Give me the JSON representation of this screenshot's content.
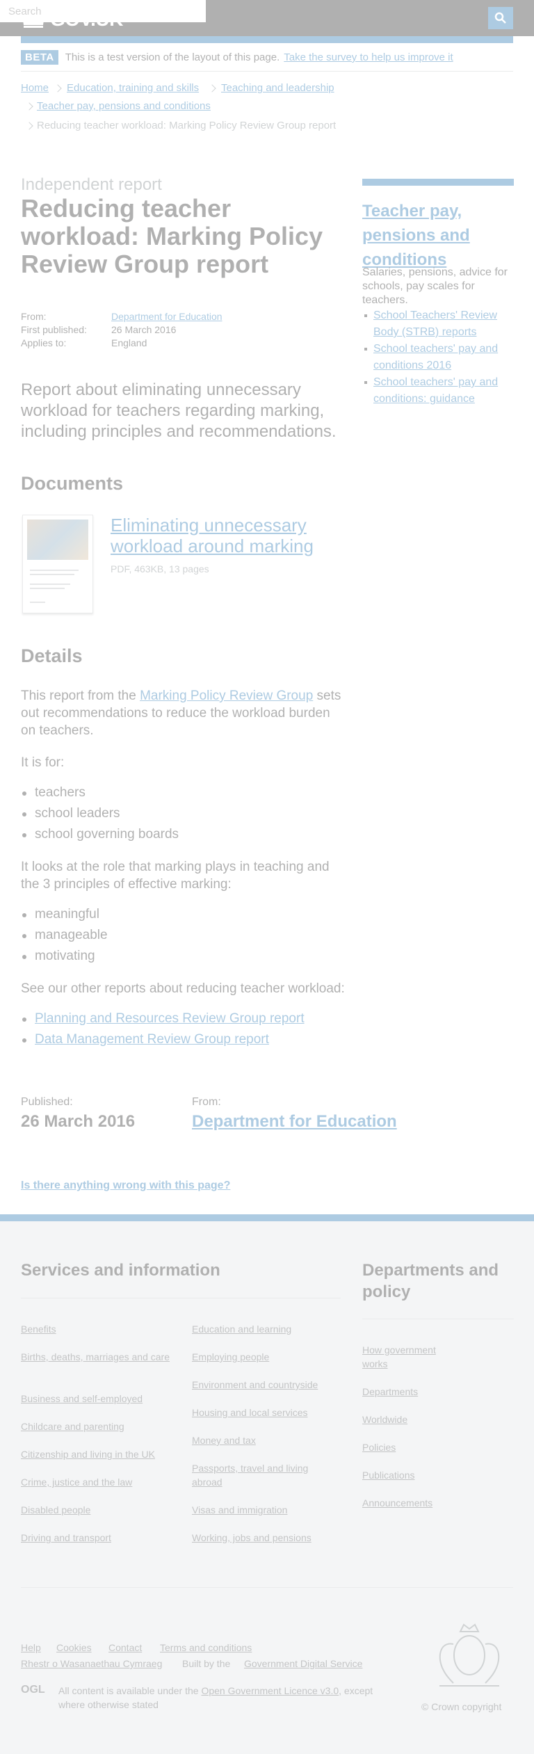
{
  "header": {
    "logo_text": "GOV.UK",
    "search_placeholder": "Search"
  },
  "beta": {
    "tag": "BETA",
    "text": "This is a test version of the layout of this page.",
    "link": "Take the survey to help us improve it"
  },
  "breadcrumb": {
    "items": [
      "Home",
      "Education, training and skills",
      "Teaching and leadership",
      "Teacher pay, pensions and conditions"
    ],
    "current": "Reducing teacher workload: Marking Policy Review Group report"
  },
  "title_block": {
    "kicker": "Independent report",
    "title": "Reducing teacher workload: Marking Policy Review Group report"
  },
  "metadata": {
    "from_label": "From:",
    "from_value": "Department for Education",
    "first_published_label": "First published:",
    "first_published_value": "26 March 2016",
    "applies_label": "Applies to:",
    "applies_value": "England"
  },
  "lead": "Report about eliminating unnecessary workload for teachers regarding marking, including principles and recommendations.",
  "sidebar": {
    "title": "Teacher pay, pensions and conditions",
    "description": "Salaries, pensions, advice for schools, pay scales for teachers.",
    "links": [
      "School Teachers' Review Body (STRB) reports",
      "School teachers' pay and conditions 2016",
      "School teachers' pay and conditions: guidance"
    ]
  },
  "documents": {
    "heading": "Documents",
    "title": "Eliminating unnecessary workload around marking",
    "meta": "PDF, 463KB, 13 pages"
  },
  "details": {
    "heading": "Details",
    "intro_before": "This report from the ",
    "intro_link": "Marking Policy Review Group",
    "intro_after": " sets out recommendations to reduce the workload burden on teachers.",
    "it_is_for": "It is for:",
    "audience": [
      "teachers",
      "school leaders",
      "school governing boards"
    ],
    "role_text": "It looks at the role that marking plays in teaching and the 3 principles of effective marking:",
    "principles": [
      "meaningful",
      "manageable",
      "motivating"
    ],
    "other_text": "See our other reports about reducing teacher workload:",
    "other_links": [
      "Planning and Resources Review Group report",
      "Data Management Review Group report"
    ]
  },
  "published": {
    "published_label": "Published:",
    "published_value": "26 March 2016",
    "from_label": "From:",
    "from_value": "Department for Education"
  },
  "feedback": {
    "link": "Is there anything wrong with this page?"
  },
  "footer": {
    "services_heading": "Services and information",
    "services_col1": [
      "Benefits",
      "Births, deaths, marriages and care",
      "Business and self-employed",
      "Childcare and parenting",
      "Citizenship and living in the UK",
      "Crime, justice and the law",
      "Disabled people",
      "Driving and transport"
    ],
    "services_col2": [
      "Education and learning",
      "Employing people",
      "Environment and countryside",
      "Housing and local services",
      "Money and tax",
      "Passports, travel and living abroad",
      "Visas and immigration",
      "Working, jobs and pensions"
    ],
    "departments_heading": "Departments and policy",
    "departments_links": [
      "How government works",
      "Departments",
      "Worldwide",
      "Policies",
      "Publications",
      "Announcements"
    ],
    "bottom_links": [
      "Help",
      "Cookies",
      "Contact",
      "Terms and conditions",
      "Rhestr o Wasanaethau Cymraeg"
    ],
    "built_by_text": "Built by the",
    "built_by_link": "Government Digital Service",
    "ogl": "OGL",
    "licence_before": "All content is available under the ",
    "licence_link": "Open Government Licence v3.0",
    "licence_after": ", except where otherwise stated",
    "copyright": "© Crown copyright"
  },
  "colors": {
    "link": "#005ea5",
    "header_bg": "#0b0c0c",
    "footer_bg": "#dee0e2",
    "overlay": "rgba(255,255,255,0.68)"
  }
}
